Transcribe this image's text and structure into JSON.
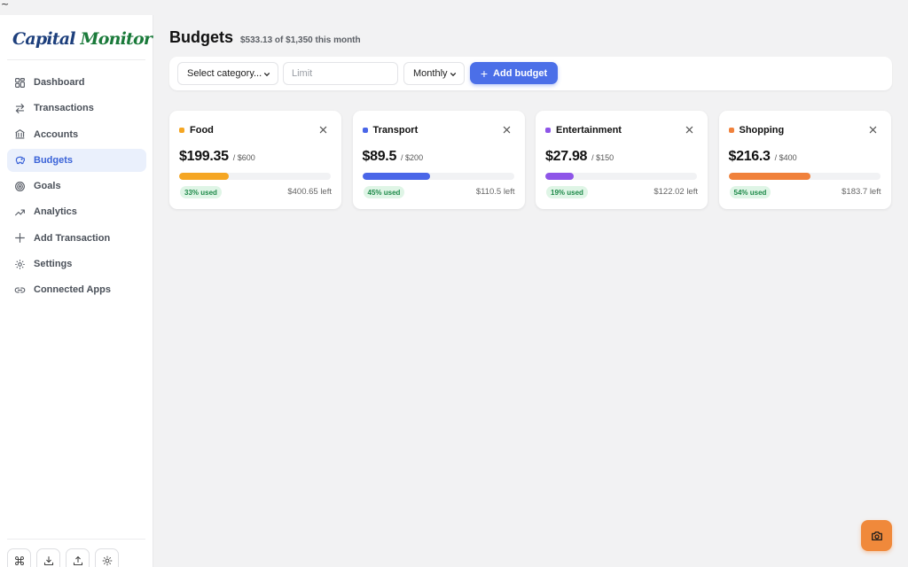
{
  "tilde": "~",
  "app": {
    "logo_part1": "Capital ",
    "logo_part2": "Monitor"
  },
  "sidebar": {
    "items": [
      {
        "label": "Dashboard",
        "icon": "grid-icon",
        "active": false
      },
      {
        "label": "Transactions",
        "icon": "arrows-icon",
        "active": false
      },
      {
        "label": "Accounts",
        "icon": "bank-icon",
        "active": false
      },
      {
        "label": "Budgets",
        "icon": "piggy-bank-icon",
        "active": true
      },
      {
        "label": "Goals",
        "icon": "target-icon",
        "active": false
      },
      {
        "label": "Analytics",
        "icon": "trend-icon",
        "active": false
      },
      {
        "label": "Add Transaction",
        "icon": "plus-icon",
        "active": false
      },
      {
        "label": "Settings",
        "icon": "gear-icon",
        "active": false
      },
      {
        "label": "Connected Apps",
        "icon": "link-icon",
        "active": false
      }
    ],
    "bottom_buttons": [
      "command-icon",
      "download-icon",
      "upload-icon",
      "sun-icon"
    ]
  },
  "header": {
    "title": "Budgets",
    "subtitle": "$533.13 of $1,350 this month"
  },
  "toolbar": {
    "category_select": "Select category...",
    "limit_placeholder": "Limit",
    "period_select": "Monthly",
    "add_button": "Add budget"
  },
  "budgets": [
    {
      "name": "Food",
      "spent": "$199.35",
      "limit": "/ $600",
      "used_pct": 33,
      "used_label": "33% used",
      "left": "$400.65 left",
      "color": "#f5a623"
    },
    {
      "name": "Transport",
      "spent": "$89.5",
      "limit": "/ $200",
      "used_pct": 45,
      "used_label": "45% used",
      "left": "$110.5 left",
      "color": "#4a66e8"
    },
    {
      "name": "Entertainment",
      "spent": "$27.98",
      "limit": "/ $150",
      "used_pct": 19,
      "used_label": "19% used",
      "left": "$122.02 left",
      "color": "#8e55e8"
    },
    {
      "name": "Shopping",
      "spent": "$216.3",
      "limit": "/ $400",
      "used_pct": 54,
      "used_label": "54% used",
      "left": "$183.7 left",
      "color": "#f0813b"
    }
  ],
  "fab": {
    "icon": "camera-icon",
    "color": "#f0893b"
  }
}
